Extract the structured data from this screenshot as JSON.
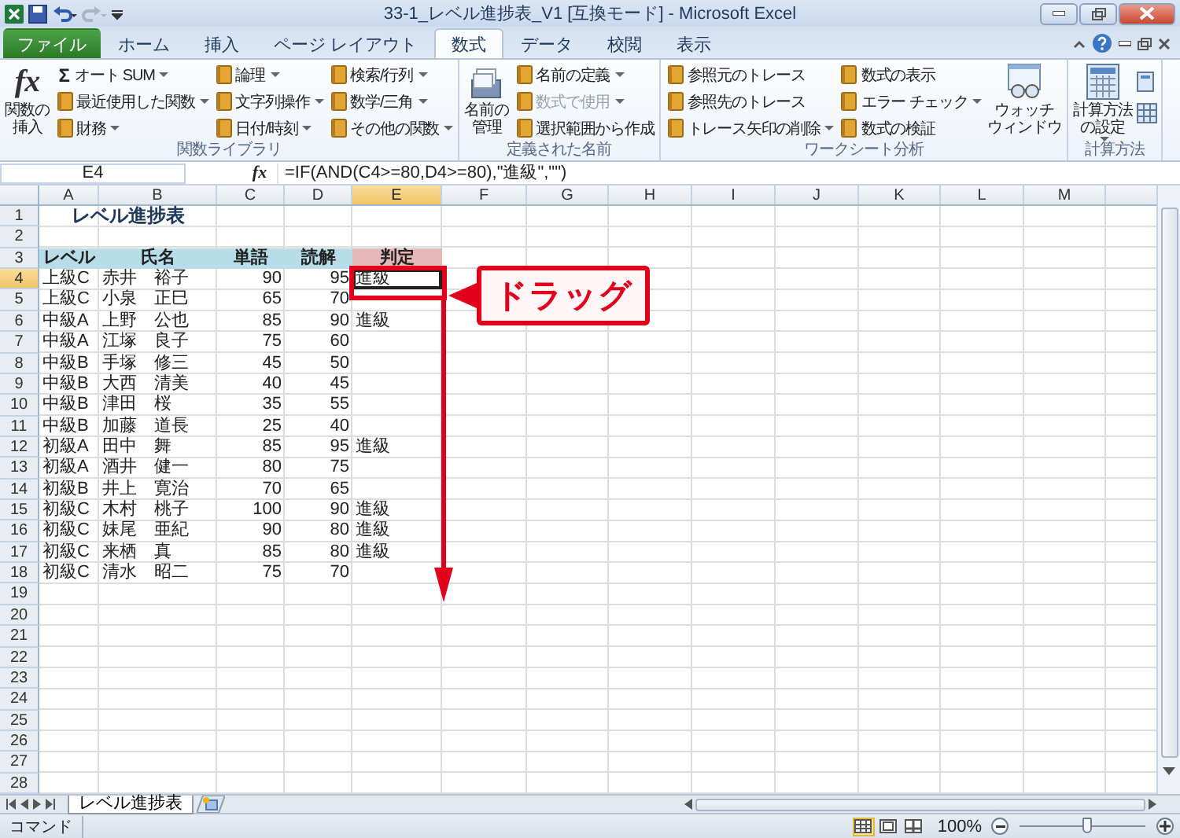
{
  "window": {
    "title": "33-1_レベル進捗表_V1  [互換モード]  -  Microsoft Excel"
  },
  "tabs": [
    {
      "label": "ファイル",
      "selected": false,
      "kind": "file"
    },
    {
      "label": "ホーム",
      "selected": false,
      "kind": "tab"
    },
    {
      "label": "挿入",
      "selected": false,
      "kind": "tab"
    },
    {
      "label": "ページ レイアウト",
      "selected": false,
      "kind": "tab"
    },
    {
      "label": "数式",
      "selected": true,
      "kind": "tab"
    },
    {
      "label": "データ",
      "selected": false,
      "kind": "tab"
    },
    {
      "label": "校閲",
      "selected": false,
      "kind": "tab"
    },
    {
      "label": "表示",
      "selected": false,
      "kind": "tab"
    }
  ],
  "ribbon": {
    "groups": [
      {
        "label": "関数ライブラリ",
        "content": [
          {
            "kind": "large",
            "symbol": "fx",
            "lines": [
              "関数の",
              "挿入"
            ],
            "dropdown": false
          },
          {
            "kind": "stack",
            "items": [
              {
                "symbol": "Σ",
                "label": "オート SUM",
                "dropdown": true,
                "disabled": false
              },
              {
                "label": "最近使用した関数",
                "dropdown": true,
                "disabled": false
              },
              {
                "label": "財務",
                "dropdown": true,
                "disabled": false
              }
            ]
          },
          {
            "kind": "stack",
            "items": [
              {
                "label": "論理",
                "dropdown": true,
                "disabled": false
              },
              {
                "label": "文字列操作",
                "dropdown": true,
                "disabled": false
              },
              {
                "label": "日付/時刻",
                "dropdown": true,
                "disabled": false
              }
            ]
          },
          {
            "kind": "stack",
            "items": [
              {
                "label": "検索/行列",
                "dropdown": true,
                "disabled": false
              },
              {
                "label": "数学/三角",
                "dropdown": true,
                "disabled": false
              },
              {
                "label": "その他の関数",
                "dropdown": true,
                "disabled": false
              }
            ]
          }
        ]
      },
      {
        "label": "定義された名前",
        "content": [
          {
            "kind": "large",
            "lines": [
              "名前の",
              "管理"
            ],
            "dropdown": false
          },
          {
            "kind": "stack",
            "items": [
              {
                "label": "名前の定義",
                "dropdown": true,
                "disabled": false
              },
              {
                "label": "数式で使用",
                "dropdown": true,
                "disabled": true
              },
              {
                "label": "選択範囲から作成",
                "dropdown": false,
                "disabled": false
              }
            ]
          }
        ]
      },
      {
        "label": "ワークシート分析",
        "content": [
          {
            "kind": "stack",
            "items": [
              {
                "label": "参照元のトレース",
                "dropdown": false,
                "disabled": false
              },
              {
                "label": "参照先のトレース",
                "dropdown": false,
                "disabled": false
              },
              {
                "label": "トレース矢印の削除",
                "dropdown": true,
                "disabled": false
              }
            ]
          },
          {
            "kind": "stack",
            "items": [
              {
                "label": "数式の表示",
                "dropdown": false,
                "disabled": false
              },
              {
                "label": "エラー チェック",
                "dropdown": true,
                "disabled": false
              },
              {
                "label": "数式の検証",
                "dropdown": false,
                "disabled": false
              }
            ]
          },
          {
            "kind": "large",
            "lines": [
              "ウォッチ",
              "ウィンドウ"
            ],
            "dropdown": false
          }
        ]
      },
      {
        "label": "計算方法",
        "content": [
          {
            "kind": "large",
            "lines": [
              "計算方法",
              "の設定"
            ],
            "dropdown": true
          },
          {
            "kind": "icons"
          }
        ]
      }
    ]
  },
  "formula_bar": {
    "name_box": "E4",
    "symbol": "fx",
    "formula": "=IF(AND(C4>=80,D4>=80),\"進級\",\"\")"
  },
  "columns": [
    {
      "label": "A",
      "selected": false
    },
    {
      "label": "B",
      "selected": false
    },
    {
      "label": "C",
      "selected": false
    },
    {
      "label": "D",
      "selected": false
    },
    {
      "label": "E",
      "selected": true
    },
    {
      "label": "F",
      "selected": false
    },
    {
      "label": "G",
      "selected": false
    },
    {
      "label": "H",
      "selected": false
    },
    {
      "label": "I",
      "selected": false
    },
    {
      "label": "J",
      "selected": false
    },
    {
      "label": "K",
      "selected": false
    },
    {
      "label": "L",
      "selected": false
    },
    {
      "label": "M",
      "selected": false
    }
  ],
  "rows": [
    {
      "header": "1",
      "selected": false,
      "cells": [
        {
          "text": "レベル進捗表",
          "kind": "title"
        }
      ]
    },
    {
      "header": "2",
      "selected": false
    },
    {
      "header": "3",
      "selected": false,
      "cells": [
        {
          "text": "レベル",
          "kind": "heading",
          "color": "#b7dee8"
        },
        {
          "text": "氏名",
          "kind": "heading",
          "color": "#b7dee8"
        },
        {
          "text": "単語",
          "kind": "heading",
          "color": "#b7dee8"
        },
        {
          "text": "読解",
          "kind": "heading",
          "color": "#b7dee8"
        },
        {
          "text": "判定",
          "kind": "heading",
          "color": "#e6b9b8"
        }
      ]
    },
    {
      "header": "4",
      "selected": true,
      "cells": [
        {
          "text": "上級C",
          "kind": "text"
        },
        {
          "text": "赤井　裕子",
          "kind": "text"
        },
        {
          "text": "90",
          "kind": "number"
        },
        {
          "text": "95",
          "kind": "number"
        },
        {
          "text": "進級",
          "kind": "text"
        }
      ]
    },
    {
      "header": "5",
      "selected": false,
      "cells": [
        {
          "text": "上級C",
          "kind": "text"
        },
        {
          "text": "小泉　正巳",
          "kind": "text"
        },
        {
          "text": "65",
          "kind": "number"
        },
        {
          "text": "70",
          "kind": "number"
        }
      ]
    },
    {
      "header": "6",
      "selected": false,
      "cells": [
        {
          "text": "中級A",
          "kind": "text"
        },
        {
          "text": "上野　公也",
          "kind": "text"
        },
        {
          "text": "85",
          "kind": "number"
        },
        {
          "text": "90",
          "kind": "number"
        },
        {
          "text": "進級",
          "kind": "text"
        }
      ]
    },
    {
      "header": "7",
      "selected": false,
      "cells": [
        {
          "text": "中級A",
          "kind": "text"
        },
        {
          "text": "江塚　良子",
          "kind": "text"
        },
        {
          "text": "75",
          "kind": "number"
        },
        {
          "text": "60",
          "kind": "number"
        }
      ]
    },
    {
      "header": "8",
      "selected": false,
      "cells": [
        {
          "text": "中級B",
          "kind": "text"
        },
        {
          "text": "手塚　修三",
          "kind": "text"
        },
        {
          "text": "45",
          "kind": "number"
        },
        {
          "text": "50",
          "kind": "number"
        }
      ]
    },
    {
      "header": "9",
      "selected": false,
      "cells": [
        {
          "text": "中級B",
          "kind": "text"
        },
        {
          "text": "大西　清美",
          "kind": "text"
        },
        {
          "text": "40",
          "kind": "number"
        },
        {
          "text": "45",
          "kind": "number"
        }
      ]
    },
    {
      "header": "10",
      "selected": false,
      "cells": [
        {
          "text": "中級B",
          "kind": "text"
        },
        {
          "text": "津田　桜",
          "kind": "text"
        },
        {
          "text": "35",
          "kind": "number"
        },
        {
          "text": "55",
          "kind": "number"
        }
      ]
    },
    {
      "header": "11",
      "selected": false,
      "cells": [
        {
          "text": "中級B",
          "kind": "text"
        },
        {
          "text": "加藤　道長",
          "kind": "text"
        },
        {
          "text": "25",
          "kind": "number"
        },
        {
          "text": "40",
          "kind": "number"
        }
      ]
    },
    {
      "header": "12",
      "selected": false,
      "cells": [
        {
          "text": "初級A",
          "kind": "text"
        },
        {
          "text": "田中　舞",
          "kind": "text"
        },
        {
          "text": "85",
          "kind": "number"
        },
        {
          "text": "95",
          "kind": "number"
        },
        {
          "text": "進級",
          "kind": "text"
        }
      ]
    },
    {
      "header": "13",
      "selected": false,
      "cells": [
        {
          "text": "初級A",
          "kind": "text"
        },
        {
          "text": "酒井　健一",
          "kind": "text"
        },
        {
          "text": "80",
          "kind": "number"
        },
        {
          "text": "75",
          "kind": "number"
        }
      ]
    },
    {
      "header": "14",
      "selected": false,
      "cells": [
        {
          "text": "初級B",
          "kind": "text"
        },
        {
          "text": "井上　寛治",
          "kind": "text"
        },
        {
          "text": "70",
          "kind": "number"
        },
        {
          "text": "65",
          "kind": "number"
        }
      ]
    },
    {
      "header": "15",
      "selected": false,
      "cells": [
        {
          "text": "初級C",
          "kind": "text"
        },
        {
          "text": "木村　桃子",
          "kind": "text"
        },
        {
          "text": "100",
          "kind": "number"
        },
        {
          "text": "90",
          "kind": "number"
        },
        {
          "text": "進級",
          "kind": "text"
        }
      ]
    },
    {
      "header": "16",
      "selected": false,
      "cells": [
        {
          "text": "初級C",
          "kind": "text"
        },
        {
          "text": "妹尾　亜紀",
          "kind": "text"
        },
        {
          "text": "90",
          "kind": "number"
        },
        {
          "text": "80",
          "kind": "number"
        },
        {
          "text": "進級",
          "kind": "text"
        }
      ]
    },
    {
      "header": "17",
      "selected": false,
      "cells": [
        {
          "text": "初級C",
          "kind": "text"
        },
        {
          "text": "来栖　真",
          "kind": "text"
        },
        {
          "text": "85",
          "kind": "number"
        },
        {
          "text": "80",
          "kind": "number"
        },
        {
          "text": "進級",
          "kind": "text"
        }
      ]
    },
    {
      "header": "18",
      "selected": false,
      "cells": [
        {
          "text": "初級C",
          "kind": "text"
        },
        {
          "text": "清水　昭二",
          "kind": "text"
        },
        {
          "text": "75",
          "kind": "number"
        },
        {
          "text": "70",
          "kind": "number"
        }
      ]
    },
    {
      "header": "19",
      "selected": false
    },
    {
      "header": "20",
      "selected": false
    },
    {
      "header": "21",
      "selected": false
    },
    {
      "header": "22",
      "selected": false
    },
    {
      "header": "23",
      "selected": false
    },
    {
      "header": "24",
      "selected": false
    },
    {
      "header": "25",
      "selected": false
    },
    {
      "header": "26",
      "selected": false
    },
    {
      "header": "27",
      "selected": false
    },
    {
      "header": "28",
      "selected": false
    }
  ],
  "callout": {
    "text": "ドラッグ"
  },
  "sheet_tabs": [
    {
      "label": "レベル進捗表",
      "selected": true
    }
  ],
  "status_bar": {
    "mode": "コマンド",
    "views": [
      {
        "kind": "normal",
        "selected": true
      },
      {
        "kind": "page-layout",
        "selected": false
      },
      {
        "kind": "page-break",
        "selected": false
      }
    ],
    "zoom": "100%",
    "zoom_slider": {
      "level": 0.54
    }
  }
}
